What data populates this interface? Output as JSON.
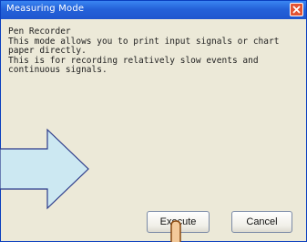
{
  "window": {
    "title": "Measuring Mode",
    "close_icon": "close-icon"
  },
  "content": {
    "description": "Pen Recorder\nThis mode allows you to print input signals or chart paper directly.\nThis is for recording relatively slow events and continuous signals."
  },
  "buttons": {
    "execute_label": "Execute",
    "cancel_label": "Cancel"
  },
  "overlay": {
    "arrow_icon": "arrow-right-icon",
    "pointer_icon": "hand-pointer-icon"
  },
  "colors": {
    "titlebar": "#2462d9",
    "close": "#e25333",
    "face": "#ece9d8",
    "arrow_fill": "#cce8f2",
    "pointer_fill": "#f3c99a"
  }
}
